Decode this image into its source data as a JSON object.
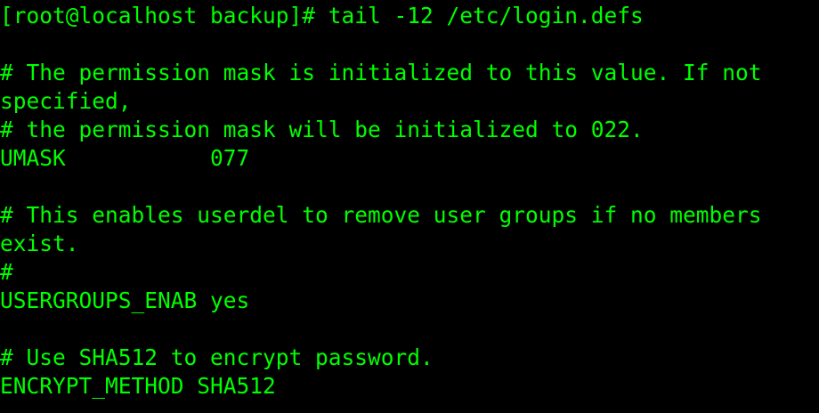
{
  "terminal": {
    "text_color": "#00ff00",
    "background_color": "#000000",
    "lines": [
      "[root@localhost backup]# tail -12 /etc/login.defs",
      "",
      "# The permission mask is initialized to this value. If not",
      "specified,",
      "# the permission mask will be initialized to 022.",
      "UMASK           077",
      "",
      "# This enables userdel to remove user groups if no members",
      "exist.",
      "#",
      "USERGROUPS_ENAB yes",
      "",
      "# Use SHA512 to encrypt password.",
      "ENCRYPT_METHOD SHA512"
    ]
  }
}
